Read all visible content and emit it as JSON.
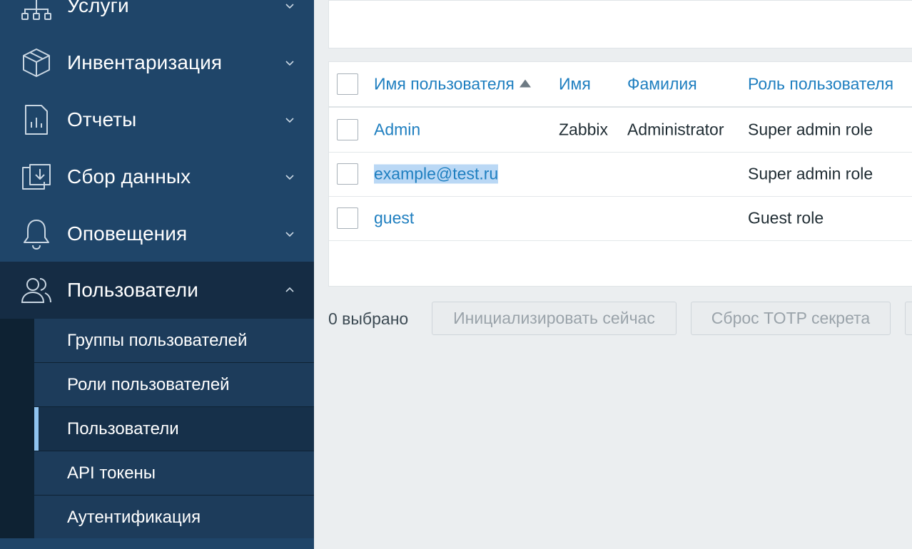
{
  "sidebar": {
    "menu": [
      {
        "label": "Услуги",
        "icon": "services-icon"
      },
      {
        "label": "Инвентаризация",
        "icon": "inventory-icon"
      },
      {
        "label": "Отчеты",
        "icon": "reports-icon"
      },
      {
        "label": "Сбор данных",
        "icon": "data-collection-icon"
      },
      {
        "label": "Оповещения",
        "icon": "bell-icon"
      },
      {
        "label": "Пользователи",
        "icon": "users-icon"
      }
    ],
    "submenu": [
      {
        "label": "Группы пользователей"
      },
      {
        "label": "Роли пользователей"
      },
      {
        "label": "Пользователи"
      },
      {
        "label": "API токены"
      },
      {
        "label": "Аутентификация"
      }
    ]
  },
  "table": {
    "headers": {
      "username": "Имя пользователя",
      "name": "Имя",
      "surname": "Фамилия",
      "role": "Роль пользователя"
    },
    "rows": [
      {
        "username": "Admin",
        "name": "Zabbix",
        "surname": "Administrator",
        "role": "Super admin role"
      },
      {
        "username": "example@test.ru",
        "name": "",
        "surname": "",
        "role": "Super admin role"
      },
      {
        "username": "guest",
        "name": "",
        "surname": "",
        "role": "Guest role"
      }
    ]
  },
  "actions": {
    "selected_count": "0 выбрано",
    "init_now": "Инициализировать сейчас",
    "reset_totp": "Сброс TOTP секрета"
  },
  "colors": {
    "sidebar_bg": "#1f4569",
    "sidebar_active": "#152c44",
    "link": "#1f7fc0",
    "selection_bar": "#90c4f0"
  }
}
